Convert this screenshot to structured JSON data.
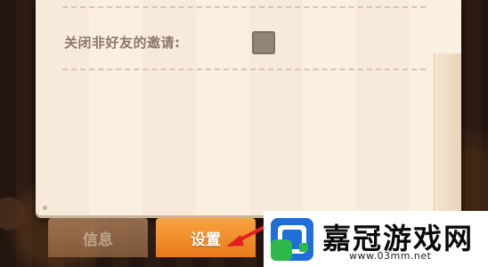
{
  "settings_panel": {
    "close_invite_label": "关闭非好友的邀请:",
    "close_invite_checked": false
  },
  "tabs": [
    {
      "label": "信息",
      "active": false
    },
    {
      "label": "设置",
      "active": true
    }
  ],
  "watermark": {
    "title": "嘉冠游戏网",
    "url": "www.03mm.net"
  },
  "colors": {
    "panel": "#fbeede",
    "active_tab": "#f08a28",
    "arrow": "#e02020"
  }
}
